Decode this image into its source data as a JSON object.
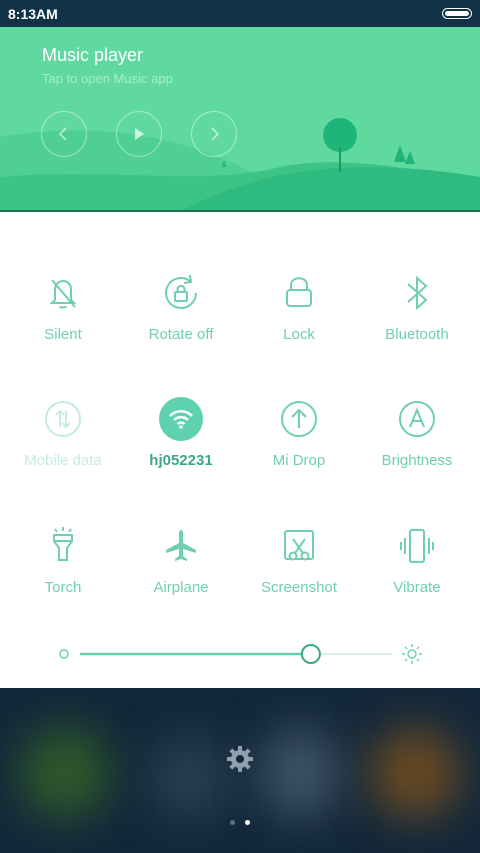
{
  "status": {
    "time": "8:13AM"
  },
  "music": {
    "title": "Music player",
    "subtitle": "Tap to open Music app"
  },
  "tiles": [
    {
      "label": "Silent",
      "icon": "bell-off-icon"
    },
    {
      "label": "Rotate off",
      "icon": "rotate-lock-icon"
    },
    {
      "label": "Lock",
      "icon": "lock-icon"
    },
    {
      "label": "Bluetooth",
      "icon": "bluetooth-icon"
    },
    {
      "label": "Mobile data",
      "icon": "mobile-data-icon"
    },
    {
      "label": "hj052231",
      "icon": "wifi-icon"
    },
    {
      "label": "Mi Drop",
      "icon": "upload-arrow-icon"
    },
    {
      "label": "Brightness",
      "icon": "auto-brightness-icon"
    },
    {
      "label": "Torch",
      "icon": "flashlight-icon"
    },
    {
      "label": "Airplane",
      "icon": "airplane-icon"
    },
    {
      "label": "Screenshot",
      "icon": "scissors-icon"
    },
    {
      "label": "Vibrate",
      "icon": "vibrate-icon"
    }
  ],
  "brightness": {
    "level": 0.74
  },
  "pager": {
    "pages": 2,
    "current": 2
  },
  "colors": {
    "accent": "#5fd1ae",
    "music_bg": "#5fd9a0",
    "status_bar": "#123247"
  }
}
